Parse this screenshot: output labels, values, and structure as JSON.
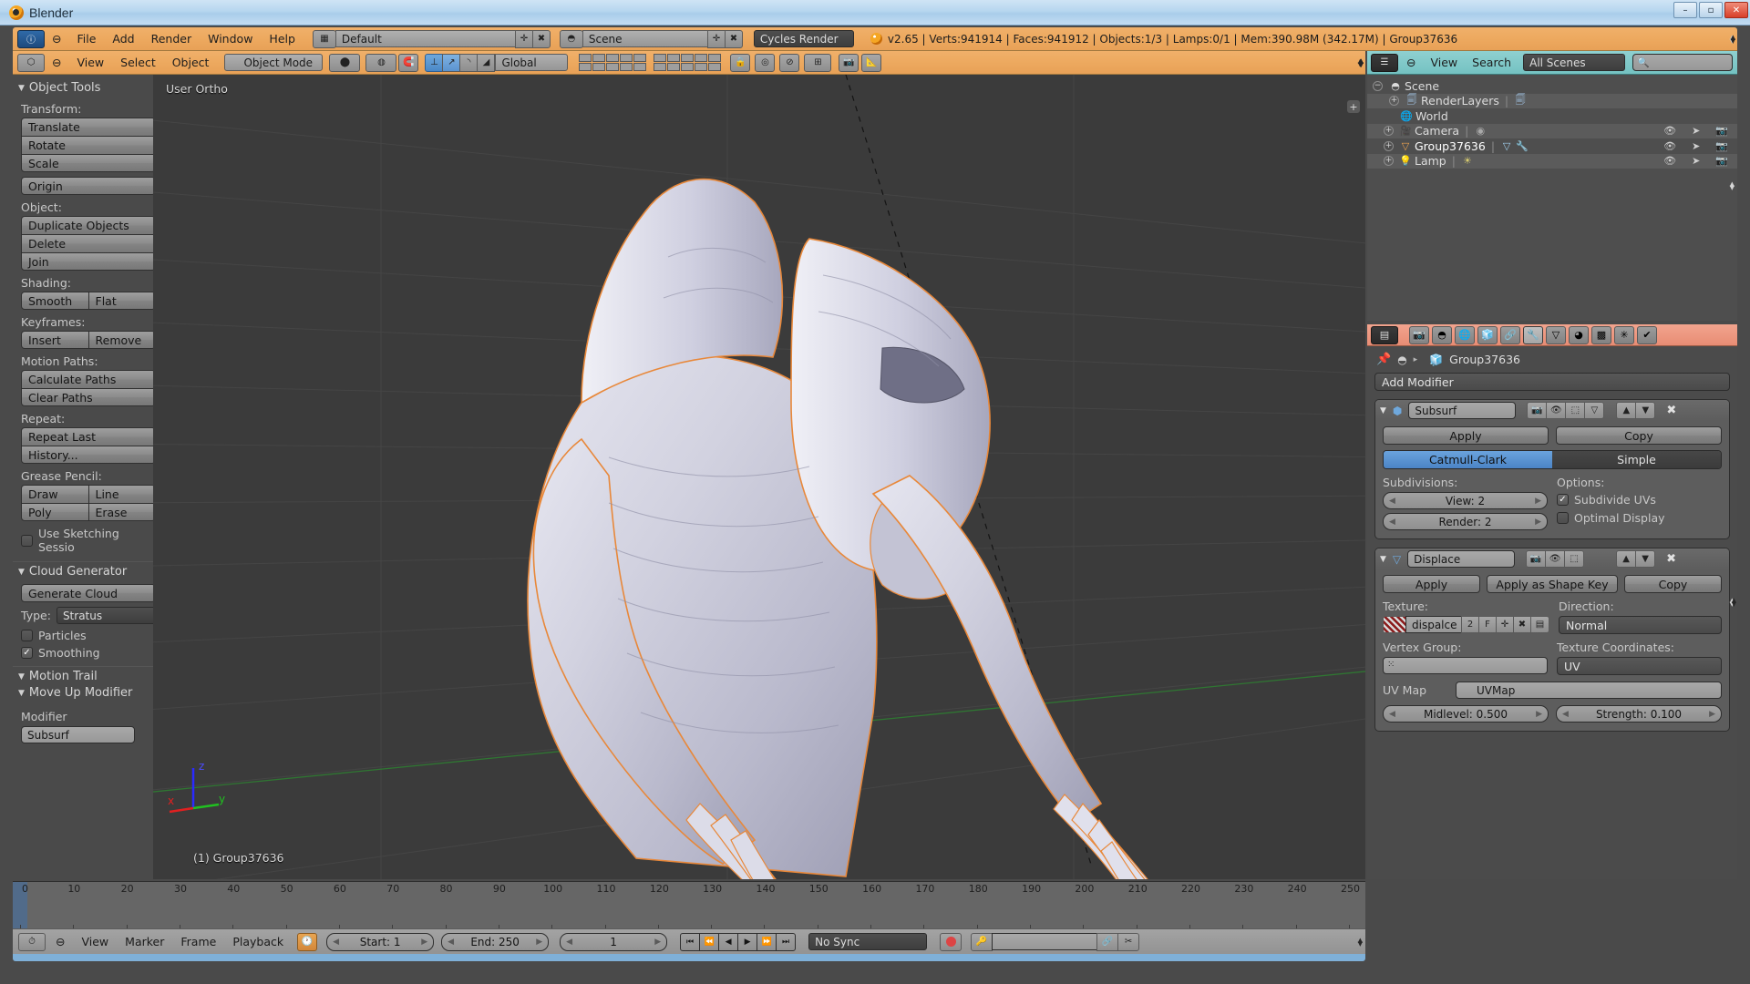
{
  "os": {
    "title": "Blender",
    "app_icon": "blender-logo-icon",
    "minimize": "–",
    "maximize": "▫",
    "close": "✕"
  },
  "topbar": {
    "editor_icon": "info-editor-icon",
    "collapse_icon": "⊖",
    "menus": [
      "File",
      "Add",
      "Render",
      "Window",
      "Help"
    ],
    "screen_layout": {
      "icon": "screen-layout-icon",
      "value": "Default",
      "add": "✛",
      "remove": "✖"
    },
    "scene": {
      "icon": "scene-icon",
      "value": "Scene",
      "add": "✛",
      "remove": "✖"
    },
    "engine": {
      "value": "Cycles Render"
    },
    "stats": "v2.65 | Verts:941914 | Faces:941912 | Objects:1/3 | Lamps:0/1 | Mem:390.98M (342.17M) | Group37636"
  },
  "viewport_header": {
    "editor_icon": "3d-view-editor-icon",
    "collapse_icon": "⊖",
    "menus": [
      "View",
      "Select",
      "Object"
    ],
    "mode": {
      "icon": "object-mode-icon",
      "value": "Object Mode"
    },
    "viewport_shading": {
      "icon": "solid-shading-icon"
    },
    "pivot": {
      "icon": "pivot-median-icon"
    },
    "snap_icon": "magnet-icon",
    "manipulators": [
      "translate-manipulator-icon",
      "rotate-manipulator-icon",
      "scale-manipulator-icon"
    ],
    "transform_orientation": "Global",
    "layers_label": "scene-layers-grid",
    "extra_icons": [
      "lock-view-icon",
      "proportional-edit-icon",
      "render-border-icon",
      "render-preview-icon",
      "object-info-icon"
    ]
  },
  "toolshelf": {
    "panels": [
      {
        "title": "Object Tools",
        "groups": [
          {
            "label": "Transform:",
            "buttons": [
              "Translate",
              "Rotate",
              "Scale"
            ]
          },
          {
            "label": "",
            "buttons": [
              "Origin"
            ]
          },
          {
            "label": "Object:",
            "buttons": [
              "Duplicate Objects",
              "Delete",
              "Join"
            ]
          },
          {
            "label": "Shading:",
            "pairs": [
              [
                "Smooth",
                "Flat"
              ]
            ]
          },
          {
            "label": "Keyframes:",
            "pairs": [
              [
                "Insert",
                "Remove"
              ]
            ]
          },
          {
            "label": "Motion Paths:",
            "buttons": [
              "Calculate Paths",
              "Clear Paths"
            ]
          },
          {
            "label": "Repeat:",
            "buttons": [
              "Repeat Last",
              "History..."
            ]
          },
          {
            "label": "Grease Pencil:",
            "pairs": [
              [
                "Draw",
                "Line"
              ],
              [
                "Poly",
                "Erase"
              ]
            ]
          }
        ],
        "checkbox": {
          "label": "Use Sketching Sessio",
          "checked": false
        }
      },
      {
        "title": "Cloud Generator",
        "button": "Generate Cloud",
        "type_label": "Type:",
        "type_value": "Stratus",
        "checks": [
          {
            "label": "Particles",
            "checked": false
          },
          {
            "label": "Smoothing",
            "checked": true
          }
        ]
      },
      {
        "title": "Motion Trail"
      },
      {
        "title": "Move Up Modifier",
        "field_label": "Modifier",
        "field_value": "Subsurf"
      }
    ]
  },
  "viewport": {
    "view_label": "User Ortho",
    "object_label": "(1) Group37636",
    "axis_x": "x",
    "axis_y": "y",
    "axis_z": "z",
    "background_color": "#3b3b3b",
    "object_description": "alien humanoid mesh sculpt, selected (orange outline)"
  },
  "outliner": {
    "editor_icon": "outliner-editor-icon",
    "collapse_icon": "⊖",
    "menus": [
      "View",
      "Search"
    ],
    "display_mode": "All Scenes",
    "search_icon": "search-icon",
    "search_placeholder": "",
    "rows": [
      {
        "name": "Scene",
        "icon": "scene-icon",
        "indent": 0,
        "expander": "−",
        "datablocks": [],
        "toggles": false
      },
      {
        "name": "RenderLayers",
        "icon": "renderlayers-icon",
        "indent": 1,
        "expander": "+",
        "datablocks": [
          "renderlayers-data-icon"
        ],
        "toggles": false
      },
      {
        "name": "World",
        "icon": "world-icon",
        "indent": 1,
        "expander": "",
        "datablocks": [],
        "toggles": false
      },
      {
        "name": "Camera",
        "icon": "camera-icon",
        "indent": 1,
        "expander": "+",
        "datablocks": [
          "camera-data-icon"
        ],
        "toggles": true
      },
      {
        "name": "Group37636",
        "icon": "group-icon",
        "indent": 1,
        "expander": "+",
        "datablocks": [
          "mesh-data-icon",
          "wrench-modifier-icon"
        ],
        "toggles": true,
        "selected": true
      },
      {
        "name": "Lamp",
        "icon": "lamp-icon",
        "indent": 1,
        "expander": "+",
        "datablocks": [
          "lamp-data-icon"
        ],
        "toggles": true
      }
    ],
    "toggle_icons": [
      "eye-icon",
      "cursor-select-icon",
      "camera-render-icon"
    ]
  },
  "properties": {
    "editor_icon": "properties-editor-icon",
    "tabs": [
      {
        "name": "render-tab",
        "icon": "camera-back-icon",
        "active": false
      },
      {
        "name": "scene-tab",
        "icon": "scene-icon",
        "active": false
      },
      {
        "name": "world-tab",
        "icon": "world-icon",
        "active": false
      },
      {
        "name": "object-tab",
        "icon": "cube-icon",
        "active": false
      },
      {
        "name": "constraints-tab",
        "icon": "chain-icon",
        "active": false
      },
      {
        "name": "modifiers-tab",
        "icon": "wrench-icon",
        "active": true
      },
      {
        "name": "data-tab",
        "icon": "mesh-data-icon",
        "active": false
      },
      {
        "name": "material-tab",
        "icon": "material-icon",
        "active": false
      },
      {
        "name": "texture-tab",
        "icon": "checker-icon",
        "active": false
      },
      {
        "name": "particles-tab",
        "icon": "particles-icon",
        "active": false
      },
      {
        "name": "physics-tab",
        "icon": "physics-icon",
        "active": false
      }
    ],
    "breadcrumb": {
      "pin_icon": "pin-icon",
      "scene_icon": "scene-icon",
      "separator": "▸",
      "object_icon": "cube-icon",
      "object_name": "Group37636"
    },
    "add_modifier": "Add Modifier",
    "modifiers": [
      {
        "type": "subsurf",
        "collapse_icon": "chevron-down-icon",
        "type_icon": "subsurf-icon",
        "name": "Subsurf",
        "header_toggles": [
          "render-visibility-icon",
          "viewport-visibility-icon",
          "edit-mode-icon",
          "cage-icon"
        ],
        "move_up_icon": "▲",
        "move_down_icon": "▼",
        "delete_icon": "✖",
        "buttons": [
          "Apply",
          "Copy"
        ],
        "algorithm": {
          "options": [
            "Catmull-Clark",
            "Simple"
          ],
          "selected": "Catmull-Clark"
        },
        "subdivisions_label": "Subdivisions:",
        "view": "View: 2",
        "render": "Render: 2",
        "options_label": "Options:",
        "options": [
          {
            "label": "Subdivide UVs",
            "checked": true
          },
          {
            "label": "Optimal Display",
            "checked": false
          }
        ]
      },
      {
        "type": "displace",
        "collapse_icon": "chevron-down-icon",
        "type_icon": "displace-icon",
        "name": "Displace",
        "header_toggles": [
          "render-visibility-icon",
          "viewport-visibility-icon",
          "edit-mode-icon"
        ],
        "move_up_icon": "▲",
        "move_down_icon": "▼",
        "delete_icon": "✖",
        "buttons": [
          "Apply",
          "Apply as Shape Key",
          "Copy"
        ],
        "texture_label": "Texture:",
        "texture_icon": "texture-checker-icon",
        "texture_name": "dispalce",
        "texture_users": "2",
        "texture_fake_user": "F",
        "texture_new": "✛",
        "texture_unlink": "✖",
        "texture_browse": "browse-texture-icon",
        "direction_label": "Direction:",
        "direction_value": "Normal",
        "vertex_group_label": "Vertex Group:",
        "vertex_group_icon": "vertex-group-icon",
        "vertex_group_value": "",
        "texcoords_label": "Texture Coordinates:",
        "texcoords_value": "UV",
        "uvmap_label": "UV Map",
        "uvmap_icon": "uv-globe-icon",
        "uvmap_value": "UVMap",
        "midlevel": "Midlevel: 0.500",
        "strength": "Strength: 0.100"
      }
    ]
  },
  "timeline": {
    "ruler_ticks": [
      0,
      10,
      20,
      30,
      40,
      50,
      60,
      70,
      80,
      90,
      100,
      110,
      120,
      130,
      140,
      150,
      160,
      170,
      180,
      190,
      200,
      210,
      220,
      230,
      240,
      250
    ],
    "editor_icon": "timeline-editor-icon",
    "collapse_icon": "⊖",
    "menus": [
      "View",
      "Marker",
      "Frame",
      "Playback"
    ],
    "lock_icon": "lock-time-icon",
    "start": "Start: 1",
    "end": "End: 250",
    "current_frame": "1",
    "transport": [
      "⏮",
      "⏪",
      "◀",
      "▶",
      "⏩",
      "⏭"
    ],
    "sync_mode": "No Sync",
    "record_icon": "record-icon",
    "keying_icon": "keying-set-icon",
    "keying_value": "",
    "link_icon": "link-icon",
    "scissors_icon": "scissors-icon"
  },
  "colors": {
    "header_orange": "#eda95f",
    "properties_salmon": "#e88d74",
    "outliner_teal": "#80c8c8",
    "viewport_bg": "#3b3b3b",
    "panel_bg": "#4a4a4a",
    "accent_blue": "#4b84c6",
    "select_orange": "#e8883a"
  }
}
